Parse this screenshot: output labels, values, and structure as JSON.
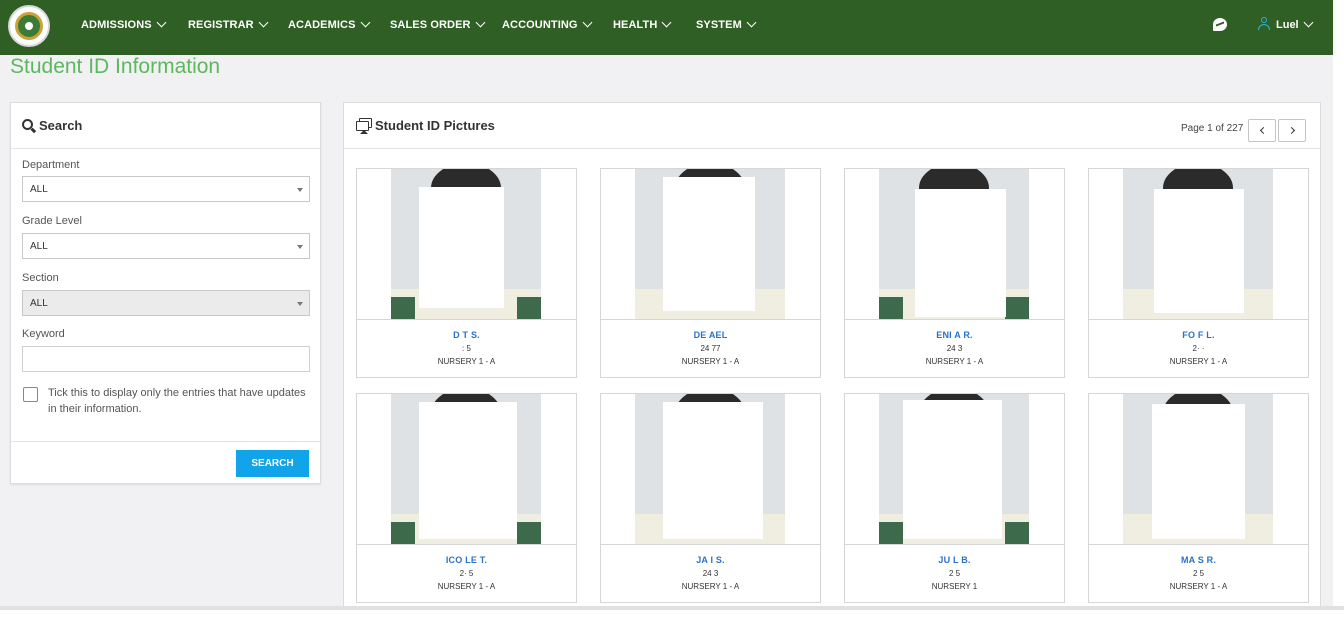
{
  "nav": {
    "items": [
      {
        "label": "ADMISSIONS"
      },
      {
        "label": "REGISTRAR"
      },
      {
        "label": "ACADEMICS"
      },
      {
        "label": "SALES ORDER"
      },
      {
        "label": "ACCOUNTING"
      },
      {
        "label": "HEALTH"
      },
      {
        "label": "SYSTEM"
      }
    ],
    "user_name": "Luel"
  },
  "page_title": "Student ID Information",
  "search": {
    "title": "Search",
    "department_label": "Department",
    "department_value": "ALL",
    "grade_label": "Grade Level",
    "grade_value": "ALL",
    "section_label": "Section",
    "section_value": "ALL",
    "keyword_label": "Keyword",
    "keyword_value": "",
    "checkbox_label": "Tick this to display only the entries that have updates in their information.",
    "button_label": "SEARCH"
  },
  "pictures": {
    "title": "Student ID Pictures",
    "page_info": "Page 1 of 227",
    "cards": [
      {
        "name": "D                           T S.",
        "id": ":      5",
        "grade": "NURSERY 1 - A"
      },
      {
        "name": "DE                          AEL",
        "id": "24    77",
        "grade": "NURSERY 1 - A"
      },
      {
        "name": "ENI                      A R.",
        "id": "24     3",
        "grade": "NURSERY 1 - A"
      },
      {
        "name": "FO                              F L.",
        "id": "2·        ·",
        "grade": "NURSERY 1 - A"
      },
      {
        "name": "ICO                           LE T.",
        "id": "2·      5",
        "grade": "NURSERY 1 - A"
      },
      {
        "name": "JA                            I S.",
        "id": "24     3",
        "grade": "NURSERY 1 - A"
      },
      {
        "name": "JU                           L B.",
        "id": "2      5",
        "grade": "NURSERY 1"
      },
      {
        "name": "MA                              S R.",
        "id": "2      5",
        "grade": "NURSERY 1 - A"
      }
    ]
  }
}
